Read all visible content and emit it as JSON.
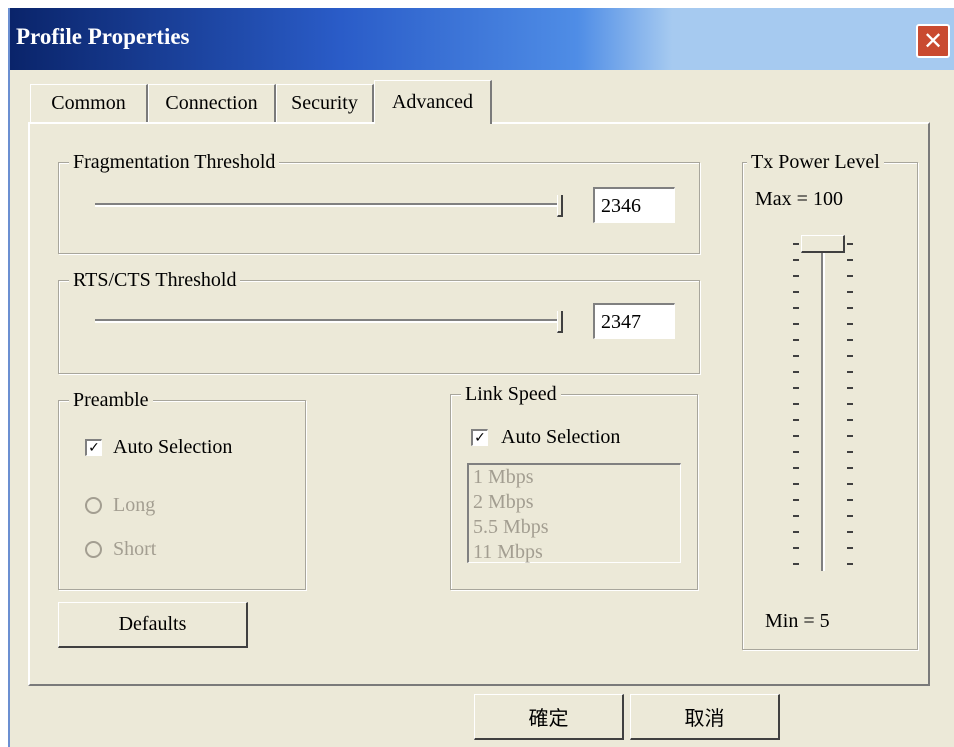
{
  "window": {
    "title": "Profile Properties",
    "close_icon": "close-icon"
  },
  "tabs": [
    {
      "label": "Common"
    },
    {
      "label": "Connection"
    },
    {
      "label": "Security"
    },
    {
      "label": "Advanced",
      "active": true
    }
  ],
  "fragmentation": {
    "label": "Fragmentation Threshold",
    "value": "2346"
  },
  "rts": {
    "label": "RTS/CTS Threshold",
    "value": "2347"
  },
  "preamble": {
    "label": "Preamble",
    "auto_label": "Auto Selection",
    "auto_checked": true,
    "options": [
      "Long",
      "Short"
    ]
  },
  "link_speed": {
    "label": "Link Speed",
    "auto_label": "Auto Selection",
    "auto_checked": true,
    "speeds": [
      "1 Mbps",
      "2 Mbps",
      "5.5 Mbps",
      "11 Mbps"
    ]
  },
  "tx_power": {
    "label": "Tx Power Level",
    "max_label": "Max = 100",
    "min_label": "Min = 5",
    "level": 100
  },
  "buttons": {
    "defaults": "Defaults",
    "ok": "確定",
    "cancel": "取消"
  }
}
